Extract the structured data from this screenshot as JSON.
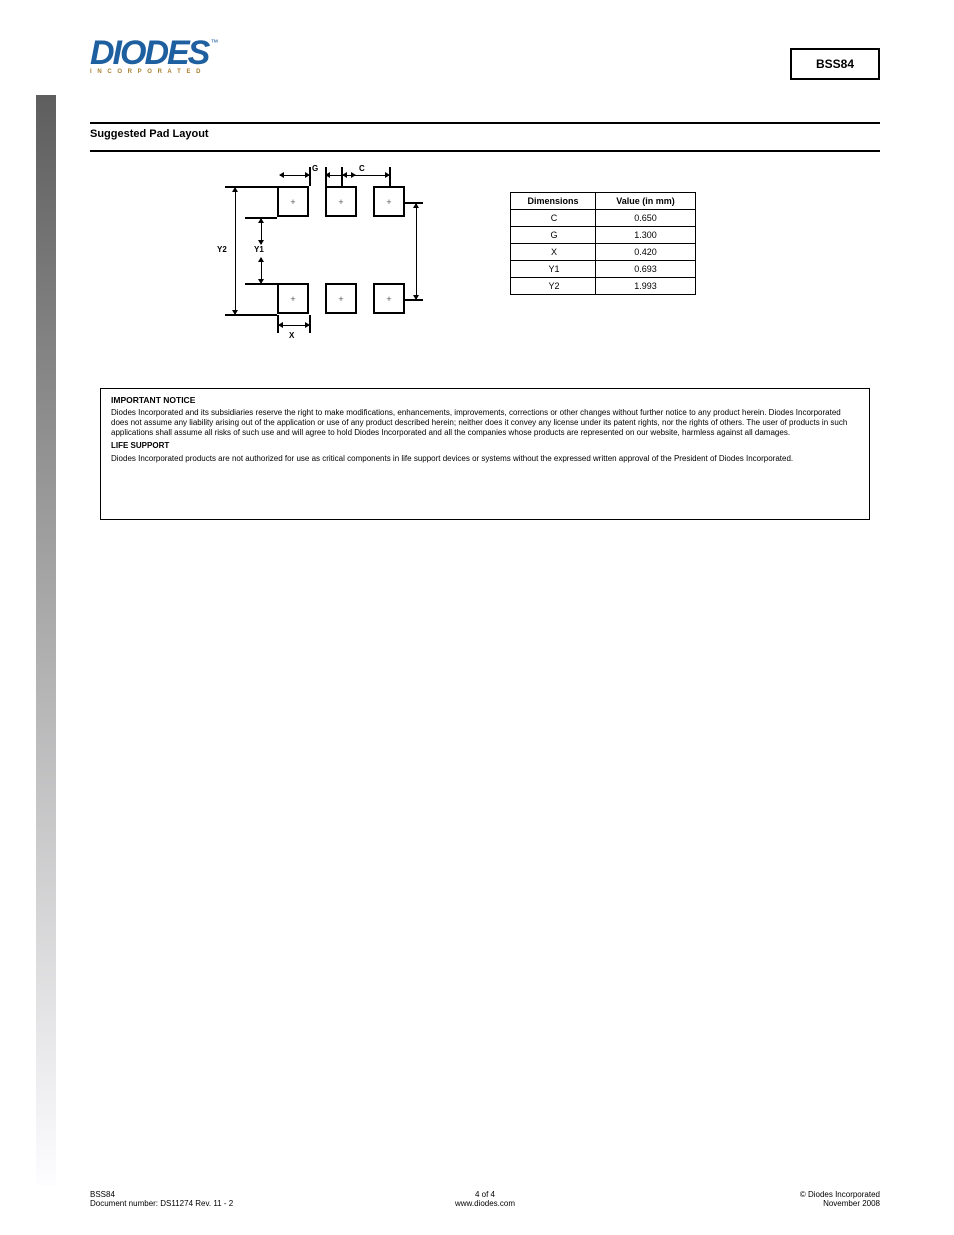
{
  "header": {
    "logo_main": "DIODES",
    "logo_sub": "I N C O R P O R A T E D",
    "part_number": "BSS84"
  },
  "section": {
    "title": "Suggested Pad Layout"
  },
  "footprint": {
    "dims": {
      "G": "G",
      "Y1": "Y1",
      "Y2": "Y2",
      "C": "C",
      "X": "X"
    }
  },
  "dim_table": {
    "header": {
      "dimensions": "Dimensions",
      "value": "Value (in mm)"
    },
    "rows": [
      {
        "k": "C",
        "v": "0.650"
      },
      {
        "k": "G",
        "v": "1.300"
      },
      {
        "k": "X",
        "v": "0.420"
      },
      {
        "k": "Y1",
        "v": "0.693"
      },
      {
        "k": "Y2",
        "v": "1.993"
      }
    ]
  },
  "legal": {
    "title": "IMPORTANT NOTICE",
    "p1": "Diodes Incorporated and its subsidiaries reserve the right to make modifications, enhancements, improvements, corrections or other changes without further notice to any product herein. Diodes Incorporated does not assume any liability arising out of the application or use of any product described herein; neither does it convey any license under its patent rights, nor the rights of others. The user of products in such applications shall assume all risks of such use and will agree to hold Diodes Incorporated and all the companies whose products are represented on our website, harmless against all damages.",
    "p2": "LIFE SUPPORT",
    "p3": "Diodes Incorporated products are not authorized for use as critical components in life support devices or systems without the expressed written approval of the President of Diodes Incorporated."
  },
  "footer": {
    "left_line1": "BSS84",
    "left_line2": "Document number: DS11274 Rev. 11 - 2",
    "center_line1": "4 of 4",
    "center_line2": "www.diodes.com",
    "right_line1": "© Diodes Incorporated",
    "right_line2": "November 2008"
  }
}
